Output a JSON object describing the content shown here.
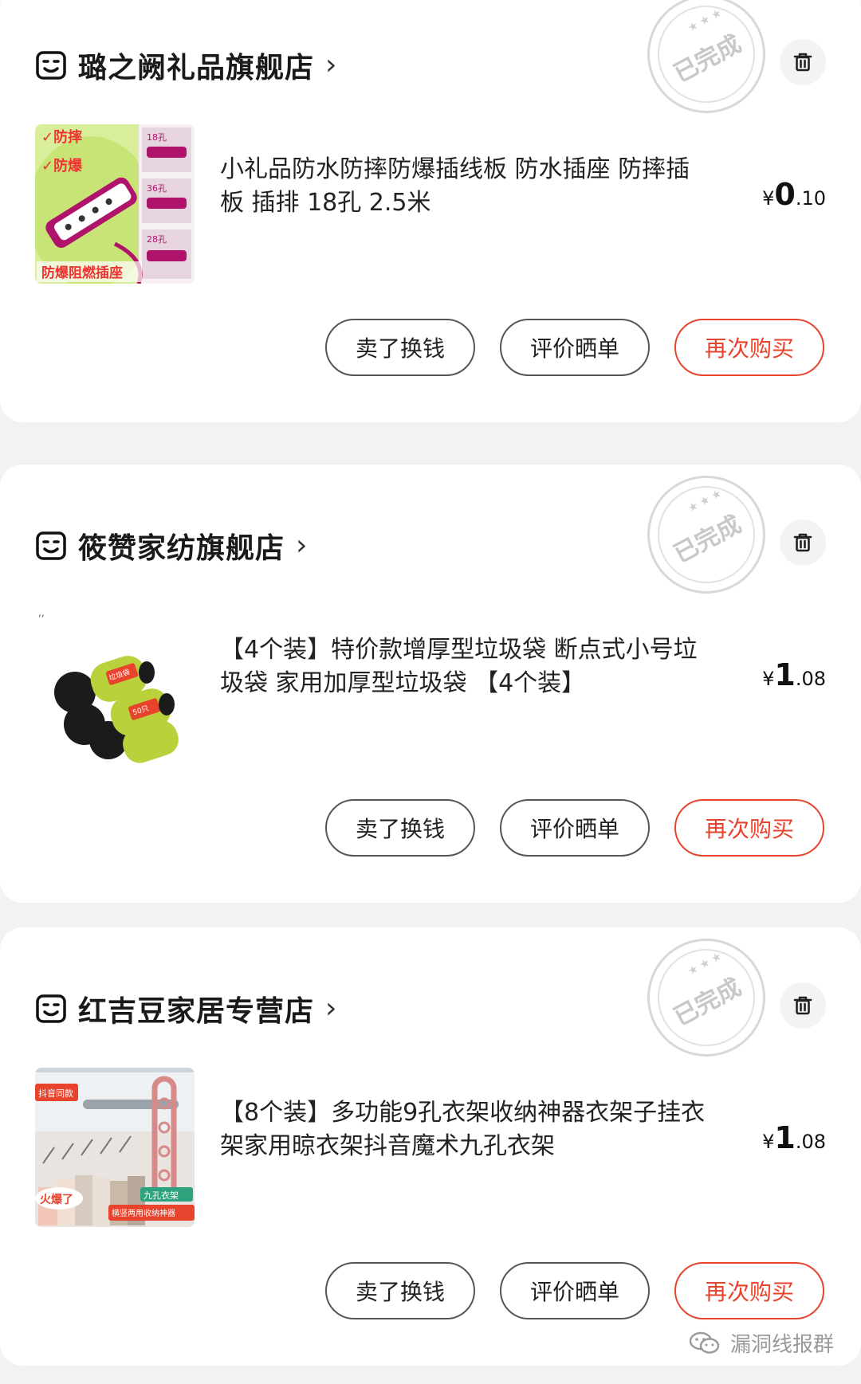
{
  "orders": [
    {
      "shop_name": "璐之阙礼品旗舰店",
      "chevron": "›",
      "stamp_text": "已完成",
      "stamp_stars": "★★★",
      "product_title": "小礼品防水防摔防爆插线板 防水插座 防摔插板 插排 18孔 2.5米",
      "thumb_labels": [
        "✓防摔",
        "✓防爆",
        "防爆阻燃插座",
        "18孔",
        "36孔",
        "28孔"
      ],
      "price": {
        "yen": "¥",
        "int": "0",
        "dec": ".10"
      },
      "buttons": {
        "sell": "卖了换钱",
        "review": "评价晒单",
        "rebuy": "再次购买"
      }
    },
    {
      "shop_name": "筱赞家纺旗舰店",
      "chevron": "›",
      "stamp_text": "已完成",
      "stamp_stars": "★★★",
      "product_title": "【4个装】特价款增厚型垃圾袋 断点式小号垃圾袋 家用加厚型垃圾袋 【4个装】",
      "thumb_labels": [
        "垃圾袋",
        "50只"
      ],
      "price": {
        "yen": "¥",
        "int": "1",
        "dec": ".08"
      },
      "buttons": {
        "sell": "卖了换钱",
        "review": "评价晒单",
        "rebuy": "再次购买"
      }
    },
    {
      "shop_name": "红吉豆家居专营店",
      "chevron": "›",
      "stamp_text": "已完成",
      "stamp_stars": "★★★",
      "product_title": "【8个装】多功能9孔衣架收纳神器衣架子挂衣架家用晾衣架抖音魔术九孔衣架",
      "thumb_labels": [
        "抖音同款",
        "火爆了",
        "九孔衣架",
        "横竖两用收纳神器"
      ],
      "price": {
        "yen": "¥",
        "int": "1",
        "dec": ".08"
      },
      "buttons": {
        "sell": "卖了换钱",
        "review": "评价晒单",
        "rebuy": "再次购买"
      }
    }
  ],
  "watermark": {
    "text": "漏洞线报群",
    "icon": "wechat-icon"
  },
  "colors": {
    "accent": "#e8432c",
    "background": "#f2f2f2",
    "card": "#ffffff"
  }
}
